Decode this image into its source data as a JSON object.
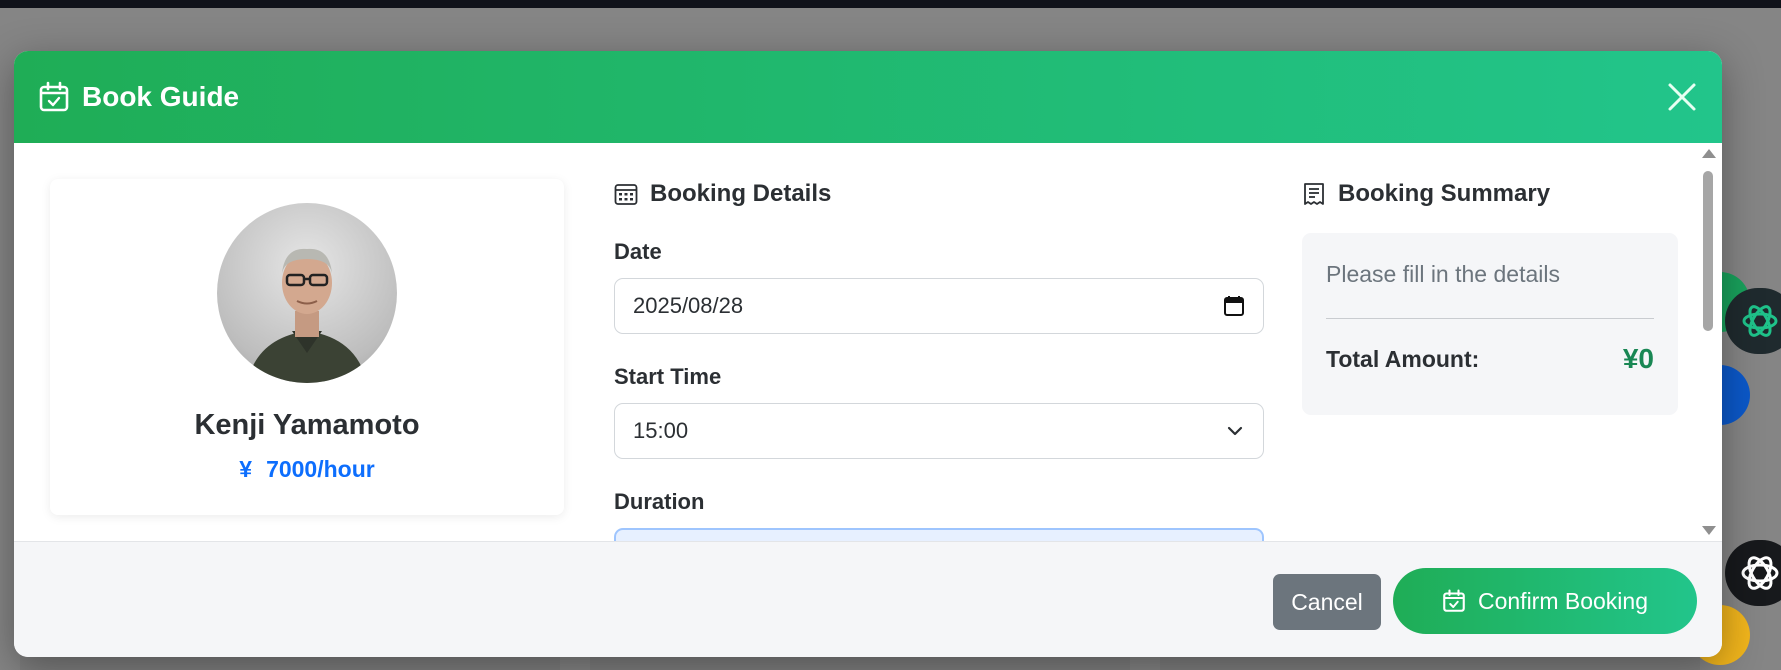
{
  "modal": {
    "title": "Book Guide",
    "title_icon": "calendar-check-icon",
    "close_icon": "close-icon"
  },
  "guide": {
    "name": "Kenji Yamamoto",
    "currency_symbol": "¥",
    "rate": "7000/hour"
  },
  "details": {
    "heading": "Booking Details",
    "heading_icon": "calendar-grid-icon",
    "date_label": "Date",
    "date_value": "2025/08/28",
    "start_time_label": "Start Time",
    "start_time_value": "15:00",
    "duration_label": "Duration"
  },
  "summary": {
    "heading": "Booking Summary",
    "heading_icon": "receipt-icon",
    "placeholder": "Please fill in the details",
    "total_label": "Total Amount:",
    "total_value": "¥0"
  },
  "footer": {
    "cancel_label": "Cancel",
    "confirm_label": "Confirm Booking"
  },
  "colors": {
    "header_gradient_start": "#1fad56",
    "header_gradient_end": "#22c58b",
    "accent_blue": "#0d6efd",
    "total_green": "#198754",
    "cancel_gray": "#6c757d"
  }
}
